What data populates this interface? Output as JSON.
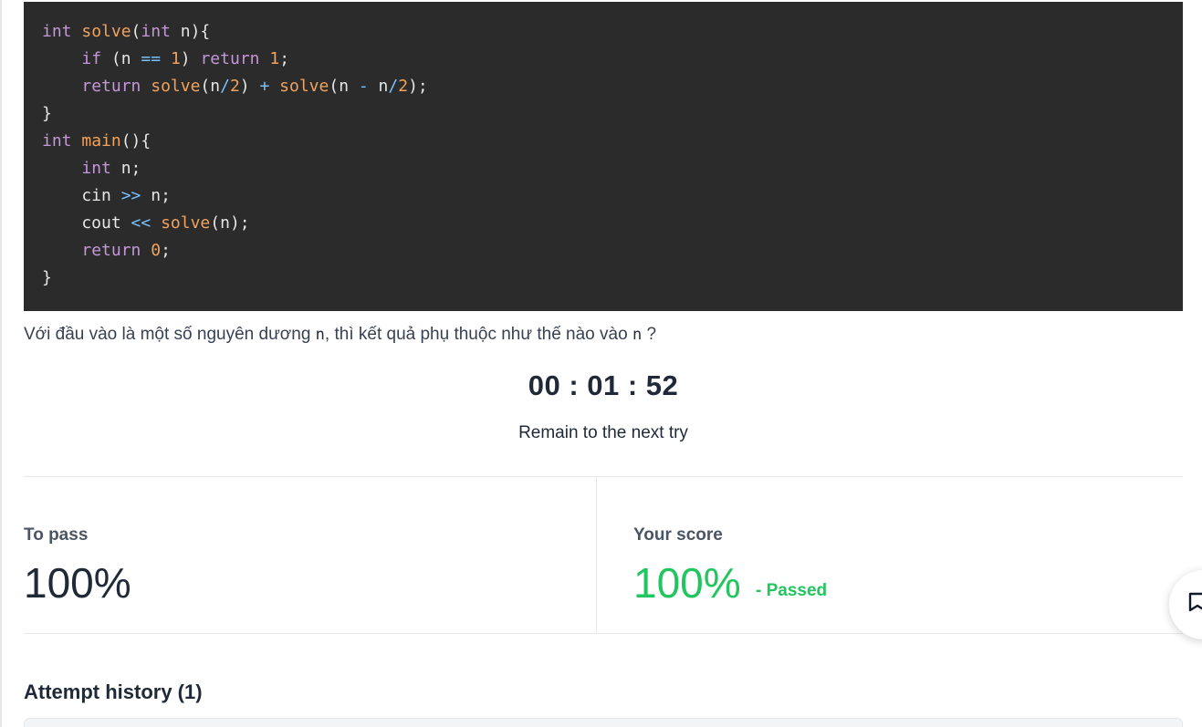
{
  "code": {
    "lines": [
      [
        {
          "t": "int",
          "c": "kw"
        },
        {
          "t": " ",
          "c": "plain"
        },
        {
          "t": "solve",
          "c": "fn"
        },
        {
          "t": "(",
          "c": "plain"
        },
        {
          "t": "int",
          "c": "kw"
        },
        {
          "t": " n){",
          "c": "plain"
        }
      ],
      [
        {
          "t": "    ",
          "c": "plain"
        },
        {
          "t": "if",
          "c": "kw"
        },
        {
          "t": " (n ",
          "c": "plain"
        },
        {
          "t": "==",
          "c": "op"
        },
        {
          "t": " ",
          "c": "plain"
        },
        {
          "t": "1",
          "c": "num"
        },
        {
          "t": ") ",
          "c": "plain"
        },
        {
          "t": "return",
          "c": "kw"
        },
        {
          "t": " ",
          "c": "plain"
        },
        {
          "t": "1",
          "c": "num"
        },
        {
          "t": ";",
          "c": "plain"
        }
      ],
      [
        {
          "t": "    ",
          "c": "plain"
        },
        {
          "t": "return",
          "c": "kw"
        },
        {
          "t": " ",
          "c": "plain"
        },
        {
          "t": "solve",
          "c": "fn"
        },
        {
          "t": "(n",
          "c": "plain"
        },
        {
          "t": "/",
          "c": "op"
        },
        {
          "t": "2",
          "c": "num"
        },
        {
          "t": ") ",
          "c": "plain"
        },
        {
          "t": "+",
          "c": "op"
        },
        {
          "t": " ",
          "c": "plain"
        },
        {
          "t": "solve",
          "c": "fn"
        },
        {
          "t": "(n ",
          "c": "plain"
        },
        {
          "t": "-",
          "c": "op"
        },
        {
          "t": " n",
          "c": "plain"
        },
        {
          "t": "/",
          "c": "op"
        },
        {
          "t": "2",
          "c": "num"
        },
        {
          "t": ");",
          "c": "plain"
        }
      ],
      [
        {
          "t": "}",
          "c": "plain"
        }
      ],
      [
        {
          "t": "int",
          "c": "kw"
        },
        {
          "t": " ",
          "c": "plain"
        },
        {
          "t": "main",
          "c": "fn"
        },
        {
          "t": "(){",
          "c": "plain"
        }
      ],
      [
        {
          "t": "    ",
          "c": "plain"
        },
        {
          "t": "int",
          "c": "kw"
        },
        {
          "t": " n;",
          "c": "plain"
        }
      ],
      [
        {
          "t": "    cin ",
          "c": "plain"
        },
        {
          "t": ">>",
          "c": "op"
        },
        {
          "t": " n;",
          "c": "plain"
        }
      ],
      [
        {
          "t": "    cout ",
          "c": "plain"
        },
        {
          "t": "<<",
          "c": "op"
        },
        {
          "t": " ",
          "c": "plain"
        },
        {
          "t": "solve",
          "c": "fn"
        },
        {
          "t": "(n);",
          "c": "plain"
        }
      ],
      [
        {
          "t": "    ",
          "c": "plain"
        },
        {
          "t": "return",
          "c": "kw"
        },
        {
          "t": " ",
          "c": "plain"
        },
        {
          "t": "0",
          "c": "num"
        },
        {
          "t": ";",
          "c": "plain"
        }
      ],
      [
        {
          "t": "}",
          "c": "plain"
        }
      ]
    ]
  },
  "question": {
    "part1": "Với đầu vào là một số nguyên dương ",
    "code1": "n",
    "part2": ", thì kết quả phụ thuộc như thế nào vào ",
    "code2": "n",
    "part3": " ?"
  },
  "timer": {
    "value": "00 : 01 : 52",
    "caption": "Remain to the next try"
  },
  "score": {
    "to_pass_label": "To pass",
    "to_pass_value": "100%",
    "your_score_label": "Your score",
    "your_score_value": "100%",
    "status": "- Passed",
    "pass_color": "#22c55e"
  },
  "history": {
    "title": "Attempt history (1)"
  },
  "floating": {
    "icon": "chat-bookmark-icon"
  }
}
